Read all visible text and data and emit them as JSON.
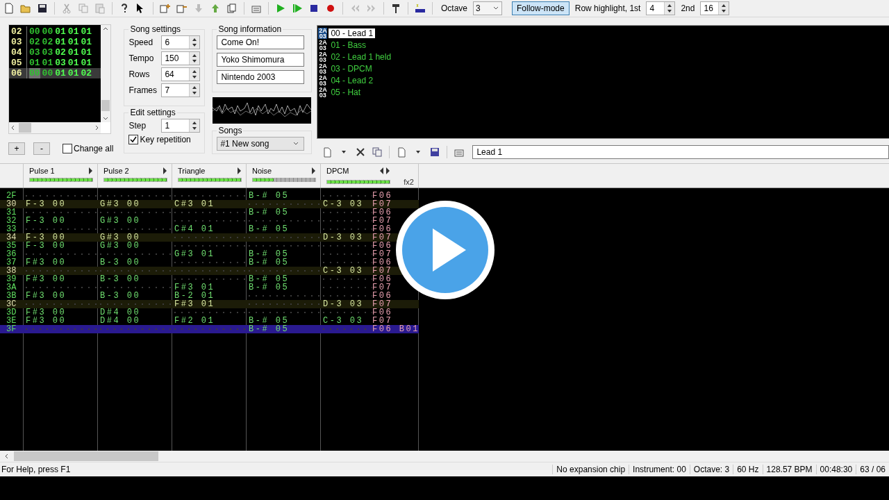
{
  "toolbar": {
    "octave_label": "Octave",
    "octave": "3",
    "follow_mode": {
      "label": "Follow-mode",
      "pressed": true
    },
    "row_highlight_label": "Row highlight, 1st",
    "row_highlight_1st": "4",
    "second_label": "2nd",
    "row_highlight_2nd": "16"
  },
  "frames": {
    "rows": [
      {
        "num": "02",
        "values": [
          "00",
          "00",
          "01",
          "01",
          "01"
        ],
        "selected": false
      },
      {
        "num": "03",
        "values": [
          "02",
          "02",
          "01",
          "01",
          "01"
        ],
        "selected": false
      },
      {
        "num": "04",
        "values": [
          "03",
          "03",
          "02",
          "01",
          "01"
        ],
        "selected": false
      },
      {
        "num": "05",
        "values": [
          "01",
          "01",
          "03",
          "01",
          "01"
        ],
        "selected": false
      },
      {
        "num": "06",
        "values": [
          "00",
          "00",
          "01",
          "01",
          "02"
        ],
        "selected": true
      }
    ],
    "add": "+",
    "remove": "-",
    "change_all": {
      "label": "Change all",
      "checked": false
    }
  },
  "song_settings": {
    "title": "Song settings",
    "fields": [
      {
        "label": "Speed",
        "value": "6"
      },
      {
        "label": "Tempo",
        "value": "150"
      },
      {
        "label": "Rows",
        "value": "64"
      },
      {
        "label": "Frames",
        "value": "7"
      }
    ]
  },
  "edit_settings": {
    "title": "Edit settings",
    "step_label": "Step",
    "step": "1",
    "key_repetition": {
      "label": "Key repetition",
      "checked": true
    }
  },
  "song_information": {
    "title": "Song information",
    "fields": [
      "Come On!",
      "Yoko Shimomura",
      "Nintendo 2003"
    ]
  },
  "songs": {
    "title": "Songs",
    "selected": "#1 New song"
  },
  "instruments": {
    "items": [
      {
        "chip": [
          "2A",
          "03"
        ],
        "name": "00 - Lead 1",
        "selected": true
      },
      {
        "chip": [
          "2A",
          "03"
        ],
        "name": "01 - Bass",
        "selected": false
      },
      {
        "chip": [
          "2A",
          "03"
        ],
        "name": "02 - Lead 1 held",
        "selected": false
      },
      {
        "chip": [
          "2A",
          "03"
        ],
        "name": "03 - DPCM",
        "selected": false
      },
      {
        "chip": [
          "2A",
          "03"
        ],
        "name": "04 - Lead 2",
        "selected": false
      },
      {
        "chip": [
          "2A",
          "03"
        ],
        "name": "05 - Hat",
        "selected": false
      }
    ],
    "name_field": "Lead 1"
  },
  "pattern": {
    "channels": [
      {
        "name": "Pulse 1",
        "level": 1
      },
      {
        "name": "Pulse 2",
        "level": 1
      },
      {
        "name": "Triangle",
        "level": 1
      },
      {
        "name": "Noise",
        "level": 0.33
      },
      {
        "name": "DPCM",
        "level": 1,
        "effect_columns": "fx2"
      }
    ],
    "rows": [
      {
        "num": "2F",
        "highlight": false,
        "selected": false,
        "cells": [
          null,
          null,
          null,
          "B-# 05",
          null
        ],
        "fx": "F06"
      },
      {
        "num": "30",
        "highlight": true,
        "selected": false,
        "cells": [
          "F-3 00",
          "G#3 00",
          "C#3 01",
          null,
          "C-3 03"
        ],
        "fx": "F07"
      },
      {
        "num": "31",
        "highlight": false,
        "selected": false,
        "cells": [
          null,
          null,
          null,
          "B-# 05",
          null
        ],
        "fx": "F06"
      },
      {
        "num": "32",
        "highlight": false,
        "selected": false,
        "cells": [
          "F-3 00",
          "G#3 00",
          null,
          null,
          null
        ],
        "fx": "F07"
      },
      {
        "num": "33",
        "highlight": false,
        "selected": false,
        "cells": [
          null,
          null,
          "C#4 01",
          "B-# 05",
          null
        ],
        "fx": "F06"
      },
      {
        "num": "34",
        "highlight": true,
        "selected": false,
        "cells": [
          "F-3 00",
          "G#3 00",
          null,
          null,
          "D-3 03"
        ],
        "fx": "F07"
      },
      {
        "num": "35",
        "highlight": false,
        "selected": false,
        "cells": [
          "F-3 00",
          "G#3 00",
          null,
          null,
          null
        ],
        "fx": "F06"
      },
      {
        "num": "36",
        "highlight": false,
        "selected": false,
        "cells": [
          null,
          null,
          "G#3 01",
          "B-# 05",
          null
        ],
        "fx": "F07"
      },
      {
        "num": "37",
        "highlight": false,
        "selected": false,
        "cells": [
          "F#3 00",
          "B-3 00",
          null,
          "B-# 05",
          null
        ],
        "fx": "F06"
      },
      {
        "num": "38",
        "highlight": true,
        "selected": false,
        "cells": [
          null,
          null,
          null,
          null,
          "C-3 03"
        ],
        "fx": "F07"
      },
      {
        "num": "39",
        "highlight": false,
        "selected": false,
        "cells": [
          "F#3 00",
          "B-3 00",
          null,
          "B-# 05",
          null
        ],
        "fx": "F06"
      },
      {
        "num": "3A",
        "highlight": false,
        "selected": false,
        "cells": [
          null,
          null,
          "F#3 01",
          "B-# 05",
          null
        ],
        "fx": "F07"
      },
      {
        "num": "3B",
        "highlight": false,
        "selected": false,
        "cells": [
          "F#3 00",
          "B-3 00",
          "B-2 01",
          null,
          null
        ],
        "fx": "F06"
      },
      {
        "num": "3C",
        "highlight": true,
        "selected": false,
        "cells": [
          null,
          null,
          "F#3 01",
          null,
          "D-3 03"
        ],
        "fx": "F07"
      },
      {
        "num": "3D",
        "highlight": false,
        "selected": false,
        "cells": [
          "F#3 00",
          "D#4 00",
          null,
          null,
          null
        ],
        "fx": "F06"
      },
      {
        "num": "3E",
        "highlight": false,
        "selected": false,
        "cells": [
          "F#3 00",
          "D#4 00",
          "F#2 01",
          "B-# 05",
          "C-3 03"
        ],
        "fx": "F07"
      },
      {
        "num": "3F",
        "highlight": false,
        "selected": true,
        "cells": [
          null,
          null,
          null,
          "B-# 05",
          null
        ],
        "fx": "F06 B01"
      }
    ]
  },
  "status_bar": {
    "help": "For Help, press F1",
    "panes": [
      "No expansion chip",
      "Instrument: 00",
      "Octave: 3",
      "60 Hz",
      "128.57 BPM",
      "00:48:30",
      "63 / 06"
    ]
  }
}
